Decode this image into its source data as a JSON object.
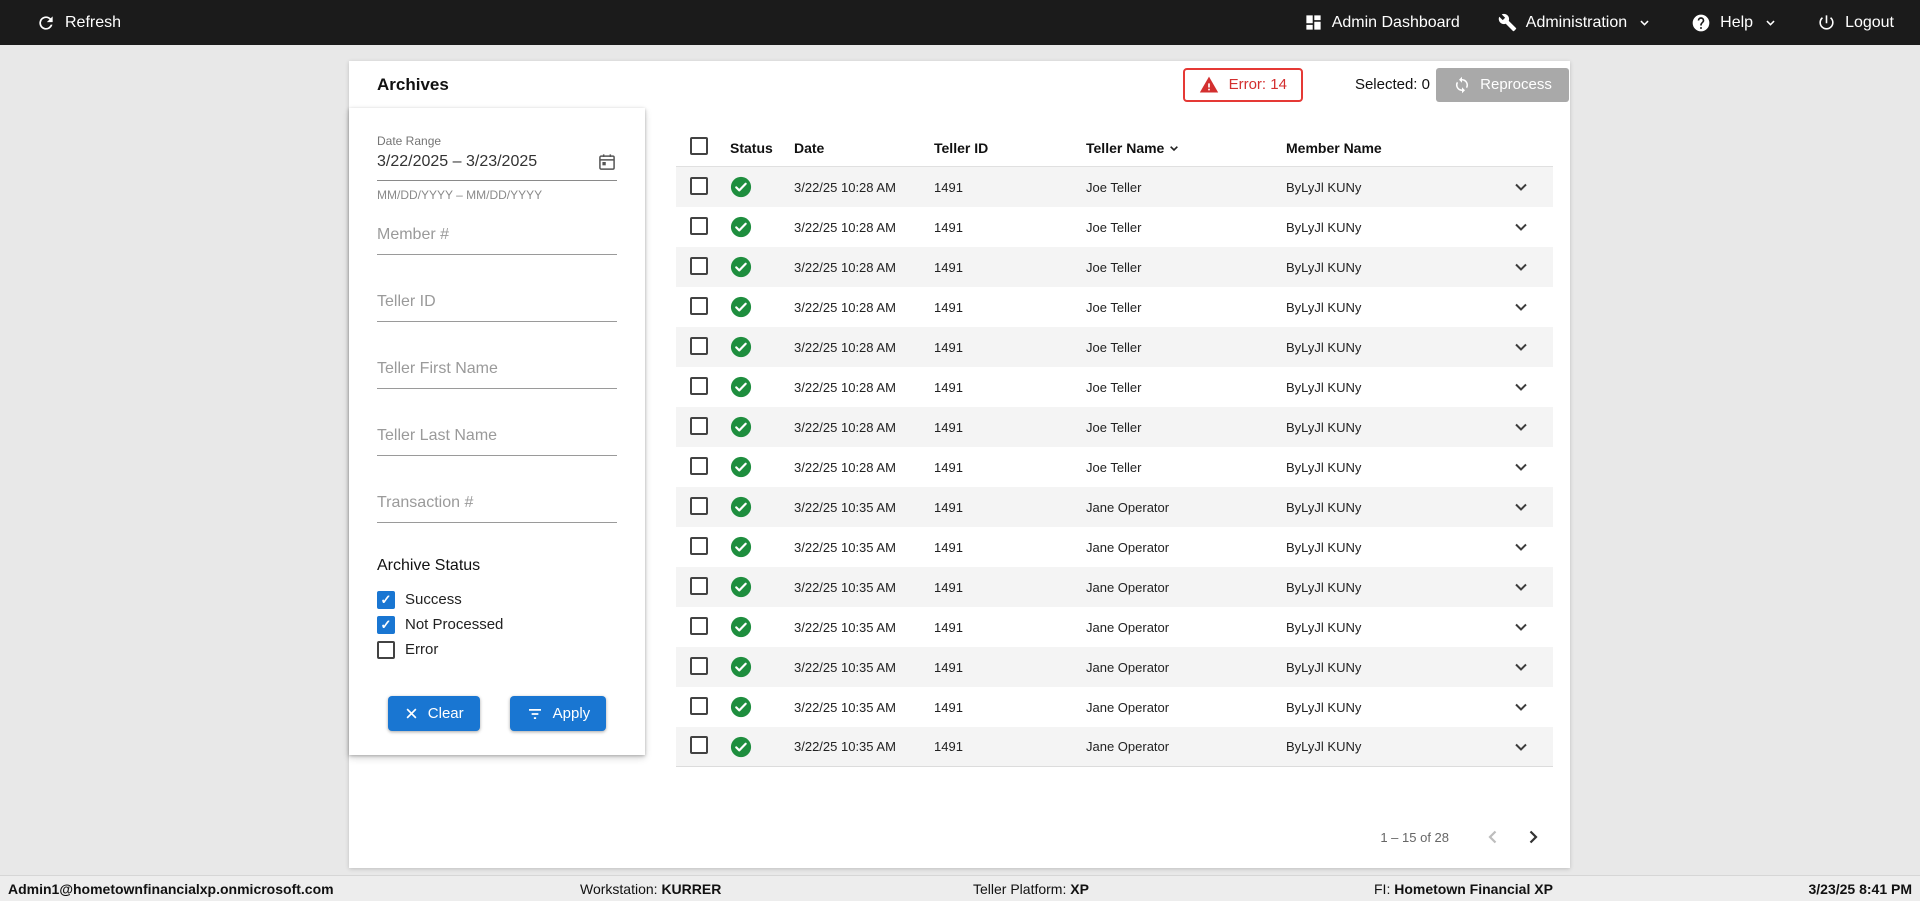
{
  "topbar": {
    "refresh_label": "Refresh",
    "admin_dashboard_label": "Admin Dashboard",
    "administration_label": "Administration",
    "help_label": "Help",
    "logout_label": "Logout"
  },
  "toolbar": {
    "title": "Archives",
    "error_button": "Error: 14",
    "selected_label": "Selected: 0",
    "reprocess_button": "Reprocess"
  },
  "filters": {
    "date_range_label": "Date Range",
    "date_range_value": "3/22/2025 – 3/23/2025",
    "date_range_hint": "MM/DD/YYYY – MM/DD/YYYY",
    "member_placeholder": "Member #",
    "teller_id_placeholder": "Teller ID",
    "teller_first_placeholder": "Teller First Name",
    "teller_last_placeholder": "Teller Last Name",
    "transaction_placeholder": "Transaction #",
    "archive_status_label": "Archive Status",
    "status_options": [
      {
        "label": "Success",
        "checked": true
      },
      {
        "label": "Not Processed",
        "checked": true
      },
      {
        "label": "Error",
        "checked": false
      }
    ],
    "clear_label": "Clear",
    "apply_label": "Apply"
  },
  "table": {
    "headers": {
      "status": "Status",
      "date": "Date",
      "teller_id": "Teller ID",
      "teller_name": "Teller Name",
      "member_name": "Member Name"
    },
    "rows": [
      {
        "status": "success",
        "date": "3/22/25 10:28 AM",
        "teller_id": "1491",
        "teller_name": "Joe Teller",
        "member_name": "ByLyJl KUNy"
      },
      {
        "status": "success",
        "date": "3/22/25 10:28 AM",
        "teller_id": "1491",
        "teller_name": "Joe Teller",
        "member_name": "ByLyJl KUNy"
      },
      {
        "status": "success",
        "date": "3/22/25 10:28 AM",
        "teller_id": "1491",
        "teller_name": "Joe Teller",
        "member_name": "ByLyJl KUNy"
      },
      {
        "status": "success",
        "date": "3/22/25 10:28 AM",
        "teller_id": "1491",
        "teller_name": "Joe Teller",
        "member_name": "ByLyJl KUNy"
      },
      {
        "status": "success",
        "date": "3/22/25 10:28 AM",
        "teller_id": "1491",
        "teller_name": "Joe Teller",
        "member_name": "ByLyJl KUNy"
      },
      {
        "status": "success",
        "date": "3/22/25 10:28 AM",
        "teller_id": "1491",
        "teller_name": "Joe Teller",
        "member_name": "ByLyJl KUNy"
      },
      {
        "status": "success",
        "date": "3/22/25 10:28 AM",
        "teller_id": "1491",
        "teller_name": "Joe Teller",
        "member_name": "ByLyJl KUNy"
      },
      {
        "status": "success",
        "date": "3/22/25 10:28 AM",
        "teller_id": "1491",
        "teller_name": "Joe Teller",
        "member_name": "ByLyJl KUNy"
      },
      {
        "status": "success",
        "date": "3/22/25 10:35 AM",
        "teller_id": "1491",
        "teller_name": "Jane Operator",
        "member_name": "ByLyJl KUNy"
      },
      {
        "status": "success",
        "date": "3/22/25 10:35 AM",
        "teller_id": "1491",
        "teller_name": "Jane Operator",
        "member_name": "ByLyJl KUNy"
      },
      {
        "status": "success",
        "date": "3/22/25 10:35 AM",
        "teller_id": "1491",
        "teller_name": "Jane Operator",
        "member_name": "ByLyJl KUNy"
      },
      {
        "status": "success",
        "date": "3/22/25 10:35 AM",
        "teller_id": "1491",
        "teller_name": "Jane Operator",
        "member_name": "ByLyJl KUNy"
      },
      {
        "status": "success",
        "date": "3/22/25 10:35 AM",
        "teller_id": "1491",
        "teller_name": "Jane Operator",
        "member_name": "ByLyJl KUNy"
      },
      {
        "status": "success",
        "date": "3/22/25 10:35 AM",
        "teller_id": "1491",
        "teller_name": "Jane Operator",
        "member_name": "ByLyJl KUNy"
      },
      {
        "status": "success",
        "date": "3/22/25 10:35 AM",
        "teller_id": "1491",
        "teller_name": "Jane Operator",
        "member_name": "ByLyJl KUNy"
      }
    ],
    "pagination": {
      "range_label": "1 – 15 of 28"
    }
  },
  "statusbar": {
    "user": "Admin1@hometownfinancialxp.onmicrosoft.com",
    "workstation_label": "Workstation: ",
    "workstation_value": "KURRER",
    "platform_label": "Teller Platform: ",
    "platform_value": "XP",
    "fi_label": "FI: ",
    "fi_value": "Hometown Financial XP",
    "datetime": "3/23/25 8:41 PM"
  },
  "colors": {
    "accent_blue": "#1976d2",
    "error_red": "#d32f2f",
    "success_green": "#1e8e3e",
    "topbar_bg": "#1b1b1b",
    "disabled_button_gray": "#a9a9a9"
  }
}
